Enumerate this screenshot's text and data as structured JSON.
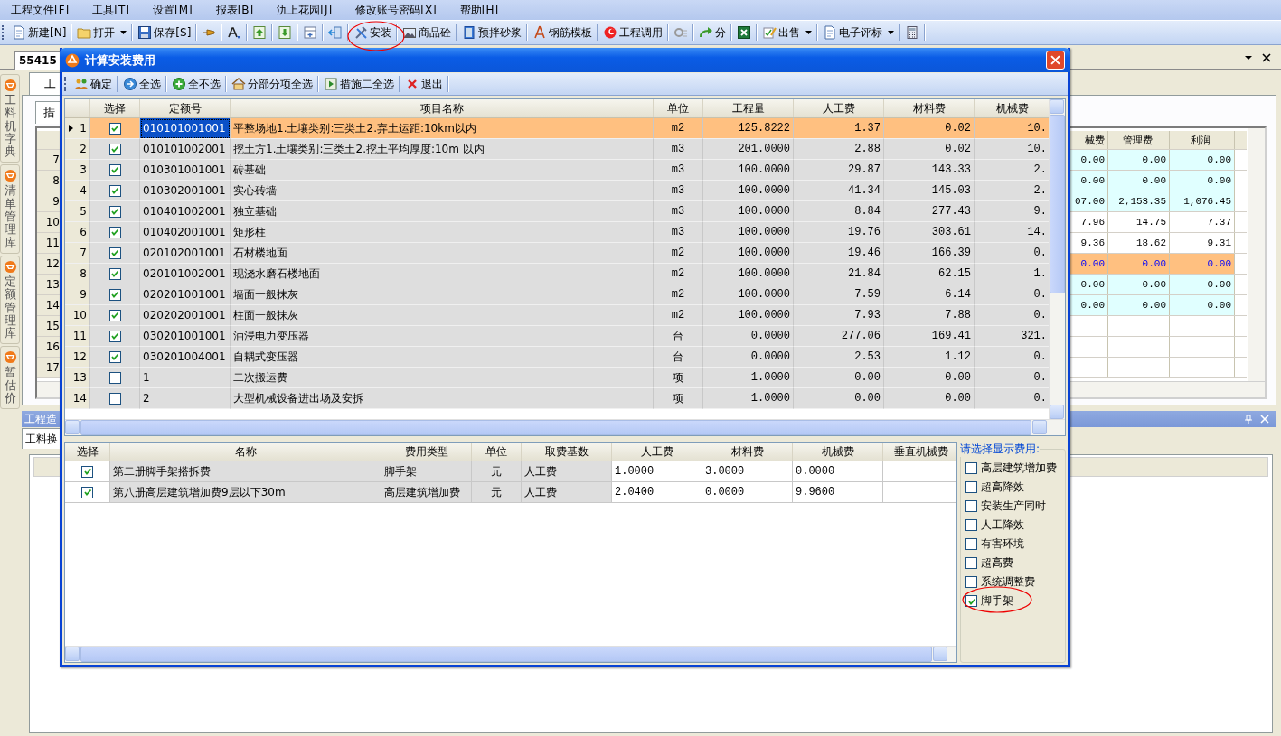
{
  "menu": [
    "工程文件[F]",
    "工具[T]",
    "设置[M]",
    "报表[B]",
    "氿上花园[J]",
    "修改账号密码[X]",
    "帮助[H]"
  ],
  "toolbar": [
    {
      "kind": "button",
      "label": "新建[N]",
      "dropdown": false
    },
    {
      "kind": "button",
      "label": "打开",
      "dropdown": true
    },
    {
      "kind": "button",
      "label": "保存[S]",
      "dropdown": false
    },
    {
      "kind": "icon",
      "dropdown": false
    },
    {
      "kind": "icon",
      "dropdown": false
    },
    {
      "kind": "icon",
      "dropdown": false
    },
    {
      "kind": "icon",
      "dropdown": false
    },
    {
      "kind": "icon",
      "dropdown": false
    },
    {
      "kind": "icon",
      "dropdown": false
    },
    {
      "kind": "button",
      "label": "安装",
      "dropdown": false
    },
    {
      "kind": "button",
      "label": "商品砼",
      "dropdown": false
    },
    {
      "kind": "button",
      "label": "预拌砂浆",
      "dropdown": false
    },
    {
      "kind": "button",
      "label": "钢筋模板",
      "dropdown": false
    },
    {
      "kind": "button",
      "label": "工程调用",
      "dropdown": false
    },
    {
      "kind": "icon",
      "dropdown": false
    },
    {
      "kind": "button",
      "label": "分",
      "dropdown": false
    },
    {
      "kind": "icon",
      "dropdown": false
    },
    {
      "kind": "button",
      "label": "出售",
      "dropdown": true
    },
    {
      "kind": "button",
      "label": "电子评标",
      "dropdown": true
    },
    {
      "kind": "icon",
      "dropdown": false
    }
  ],
  "document_tab": {
    "label": "55415"
  },
  "sidebar": [
    {
      "label": "工料机字典"
    },
    {
      "label": "清单管理库"
    },
    {
      "label": "定额管理库"
    },
    {
      "label": "暂估价"
    }
  ],
  "main_tab": {
    "label": "工"
  },
  "sub_tab": {
    "label": "措"
  },
  "background_table": {
    "columns": [
      "械费",
      "管理费",
      "利润"
    ],
    "rows": [
      {
        "no": "7",
        "selected": false,
        "kind": "group",
        "values": [
          "0.00",
          "0.00",
          "0.00"
        ]
      },
      {
        "no": "8",
        "selected": false,
        "kind": "group",
        "values": [
          "0.00",
          "0.00",
          "0.00"
        ]
      },
      {
        "no": "9",
        "selected": false,
        "kind": "group",
        "values": [
          "07.00",
          "2,153.35",
          "1,076.45"
        ]
      },
      {
        "no": "10",
        "selected": false,
        "kind": "item",
        "values": [
          "7.96",
          "14.75",
          "7.37"
        ]
      },
      {
        "no": "11",
        "selected": false,
        "kind": "item",
        "values": [
          "9.36",
          "18.62",
          "9.31"
        ]
      },
      {
        "no": "12",
        "selected": true,
        "kind": "item",
        "values": [
          "0.00",
          "0.00",
          "0.00"
        ]
      },
      {
        "no": "13",
        "selected": false,
        "kind": "group",
        "values": [
          "0.00",
          "0.00",
          "0.00"
        ]
      },
      {
        "no": "14",
        "selected": false,
        "kind": "group",
        "values": [
          "0.00",
          "0.00",
          "0.00"
        ]
      },
      {
        "no": "15",
        "selected": false,
        "kind": "item"
      },
      {
        "no": "16",
        "selected": false,
        "kind": "item"
      },
      {
        "no": "17",
        "selected": false,
        "kind": "item"
      }
    ]
  },
  "bottom_panel": {
    "title": "工程造",
    "tab": "工料换"
  },
  "dialog": {
    "title": "计算安装费用",
    "toolbar": [
      "确定",
      "全选",
      "全不选",
      "分部分项全选",
      "措施二全选",
      "退出"
    ],
    "grid": {
      "columns": [
        "选择",
        "定额号",
        "项目名称",
        "单位",
        "工程量",
        "人工费",
        "材料费",
        "机械费"
      ],
      "rows": [
        {
          "no": "1",
          "selected": true,
          "checked": true,
          "code": "010101001001",
          "name": "平整场地1.土壤类别:三类土2.弃土运距:10km以内",
          "unit": "m2",
          "qty": "125.8222",
          "labor": "1.37",
          "material": "0.02",
          "machine": "10."
        },
        {
          "no": "2",
          "selected": false,
          "checked": true,
          "code": "010101002001",
          "name": "挖土方1.土壤类别:三类土2.挖土平均厚度:10m 以内",
          "unit": "m3",
          "qty": "201.0000",
          "labor": "2.88",
          "material": "0.02",
          "machine": "10."
        },
        {
          "no": "3",
          "selected": false,
          "checked": true,
          "code": "010301001001",
          "name": "砖基础",
          "unit": "m3",
          "qty": "100.0000",
          "labor": "29.87",
          "material": "143.33",
          "machine": "2."
        },
        {
          "no": "4",
          "selected": false,
          "checked": true,
          "code": "010302001001",
          "name": "实心砖墙",
          "unit": "m3",
          "qty": "100.0000",
          "labor": "41.34",
          "material": "145.03",
          "machine": "2."
        },
        {
          "no": "5",
          "selected": false,
          "checked": true,
          "code": "010401002001",
          "name": "独立基础",
          "unit": "m3",
          "qty": "100.0000",
          "labor": "8.84",
          "material": "277.43",
          "machine": "9."
        },
        {
          "no": "6",
          "selected": false,
          "checked": true,
          "code": "010402001001",
          "name": "矩形柱",
          "unit": "m3",
          "qty": "100.0000",
          "labor": "19.76",
          "material": "303.61",
          "machine": "14."
        },
        {
          "no": "7",
          "selected": false,
          "checked": true,
          "code": "020102001001",
          "name": "石材楼地面",
          "unit": "m2",
          "qty": "100.0000",
          "labor": "19.46",
          "material": "166.39",
          "machine": "0."
        },
        {
          "no": "8",
          "selected": false,
          "checked": true,
          "code": "020101002001",
          "name": "现浇水磨石楼地面",
          "unit": "m2",
          "qty": "100.0000",
          "labor": "21.84",
          "material": "62.15",
          "machine": "1."
        },
        {
          "no": "9",
          "selected": false,
          "checked": true,
          "code": "020201001001",
          "name": "墙面一般抹灰",
          "unit": "m2",
          "qty": "100.0000",
          "labor": "7.59",
          "material": "6.14",
          "machine": "0."
        },
        {
          "no": "10",
          "selected": false,
          "checked": true,
          "code": "020202001001",
          "name": "柱面一般抹灰",
          "unit": "m2",
          "qty": "100.0000",
          "labor": "7.93",
          "material": "7.88",
          "machine": "0."
        },
        {
          "no": "11",
          "selected": false,
          "checked": true,
          "code": "030201001001",
          "name": "油浸电力变压器",
          "unit": "台",
          "qty": "0.0000",
          "labor": "277.06",
          "material": "169.41",
          "machine": "321."
        },
        {
          "no": "12",
          "selected": false,
          "checked": true,
          "code": "030201004001",
          "name": "自耦式变压器",
          "unit": "台",
          "qty": "0.0000",
          "labor": "2.53",
          "material": "1.12",
          "machine": "0."
        },
        {
          "no": "13",
          "selected": false,
          "checked": false,
          "code": "1",
          "name": "二次搬运费",
          "unit": "项",
          "qty": "1.0000",
          "labor": "0.00",
          "material": "0.00",
          "machine": "0."
        },
        {
          "no": "14",
          "selected": false,
          "checked": false,
          "code": "2",
          "name": "大型机械设备进出场及安拆",
          "unit": "项",
          "qty": "1.0000",
          "labor": "0.00",
          "material": "0.00",
          "machine": "0."
        }
      ]
    },
    "fee_grid": {
      "columns": [
        "选择",
        "名称",
        "费用类型",
        "单位",
        "取费基数",
        "人工费",
        "材料费",
        "机械费",
        "垂直机械费"
      ],
      "rows": [
        {
          "checked": true,
          "name": "第二册脚手架搭拆费",
          "type": "脚手架",
          "unit": "元",
          "base": "人工费",
          "labor": "1.0000",
          "material": "3.0000",
          "machine": "0.0000"
        },
        {
          "checked": true,
          "name": "第八册高层建筑增加费9层以下30m",
          "type": "高层建筑增加费",
          "unit": "元",
          "base": "人工费",
          "labor": "2.0400",
          "material": "0.0000",
          "machine": "9.9600"
        }
      ]
    },
    "filter": {
      "legend": "请选择显示费用:",
      "options": [
        {
          "label": "高层建筑增加费",
          "checked": false
        },
        {
          "label": "超高降效",
          "checked": false
        },
        {
          "label": "安装生产同时",
          "checked": false
        },
        {
          "label": "人工降效",
          "checked": false
        },
        {
          "label": "有害环境",
          "checked": false
        },
        {
          "label": "超高费",
          "checked": false
        },
        {
          "label": "系统调整费",
          "checked": false
        },
        {
          "label": "脚手架",
          "checked": true
        }
      ]
    }
  }
}
